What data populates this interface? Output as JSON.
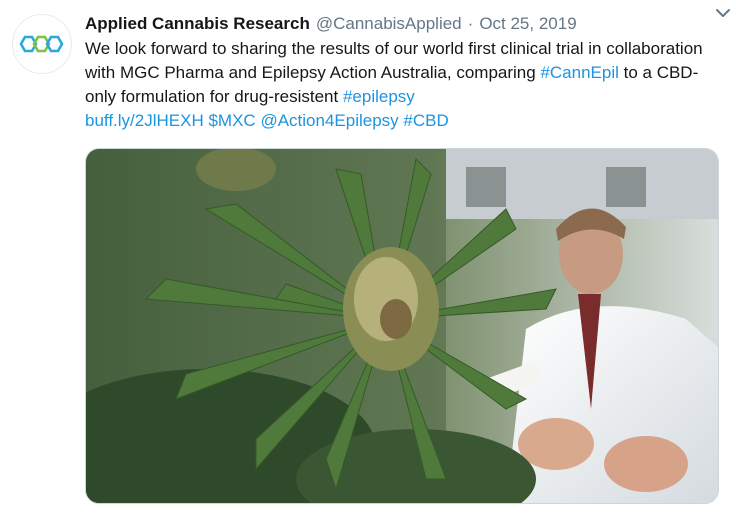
{
  "tweet": {
    "author_name": "Applied Cannabis Research",
    "handle": "@CannabisApplied",
    "separator": "·",
    "date": "Oct 25, 2019",
    "text_part1": "We look forward to sharing the results of our world first clinical trial in collaboration with MGC Pharma and Epilepsy Action Australia, comparing ",
    "hashtag_cannepil": "#CannEpil",
    "text_part2": " to a CBD-only formulation for drug-resistent ",
    "hashtag_epilepsy": "#epilepsy",
    "link_url": "buff.ly/2JlHEXH",
    "cashtag": "$MXC",
    "mention": "@Action4Epilepsy",
    "hashtag_cbd": "#CBD"
  },
  "icons": {
    "avatar": "hexagon-chain-logo",
    "more": "chevron-down-icon"
  },
  "colors": {
    "link": "#1b95e0",
    "logo_green": "#7cc242",
    "logo_blue": "#29a9d8",
    "muted": "#657786"
  },
  "media": {
    "description_icon": "cannabis-plant-photo"
  }
}
